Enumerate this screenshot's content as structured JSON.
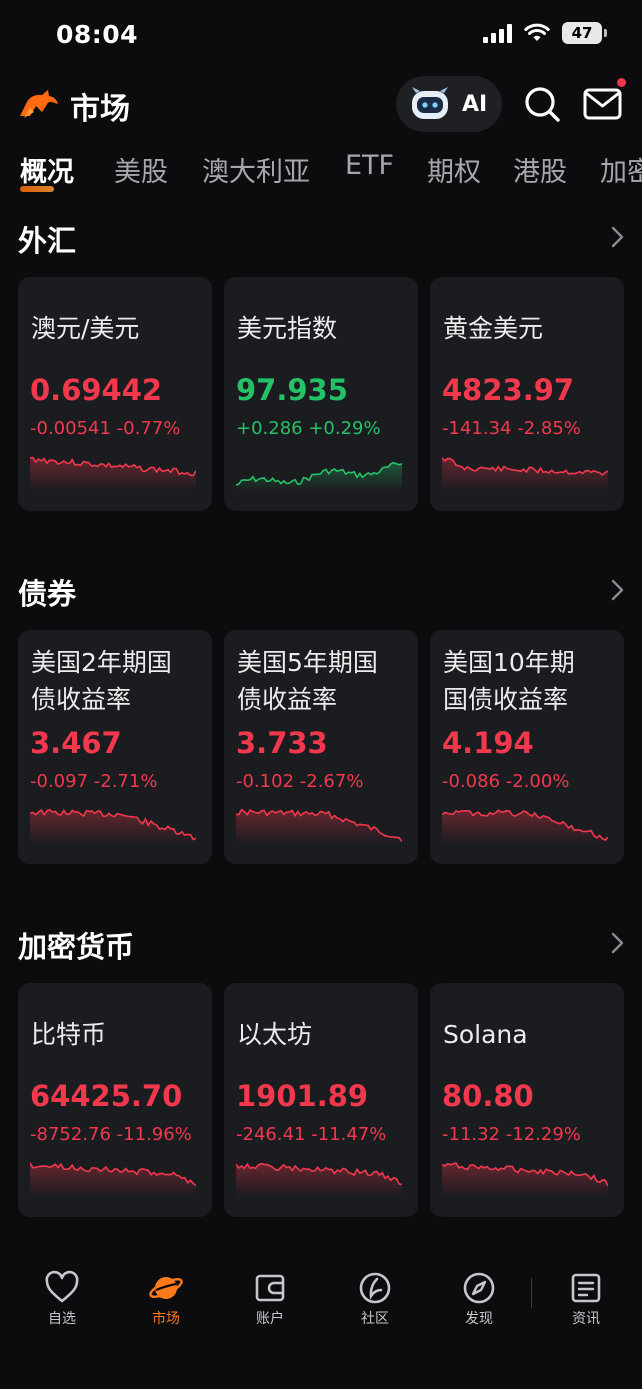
{
  "status_bar": {
    "time": "08:04",
    "battery": "47",
    "icons": [
      "signal-icon",
      "wifi-icon",
      "battery-icon"
    ]
  },
  "header": {
    "title": "市场",
    "ai_label": "AI",
    "icons": [
      "bull-logo-icon",
      "robot-icon",
      "search-icon",
      "mail-icon"
    ],
    "has_notification_dot": true
  },
  "tabs": [
    {
      "label": "概况",
      "active": true
    },
    {
      "label": "美股"
    },
    {
      "label": "澳大利亚"
    },
    {
      "label": "ETF"
    },
    {
      "label": "期权"
    },
    {
      "label": "港股"
    },
    {
      "label": "加密"
    }
  ],
  "sections": [
    {
      "title": "外汇",
      "cards": [
        {
          "name": "澳元/美元",
          "price": "0.69442",
          "change": "-0.00541 -0.77%",
          "trend": "down"
        },
        {
          "name": "美元指数",
          "price": "97.935",
          "change": "+0.286 +0.29%",
          "trend": "up"
        },
        {
          "name": "黄金美元",
          "price": "4823.97",
          "change": "-141.34 -2.85%",
          "trend": "down"
        }
      ]
    },
    {
      "title": "债券",
      "cards": [
        {
          "name": "美国2年期国",
          "name2": "债收益率",
          "price": "3.467",
          "change": "-0.097 -2.71%",
          "trend": "down"
        },
        {
          "name": "美国5年期国",
          "name2": "债收益率",
          "price": "3.733",
          "change": "-0.102 -2.67%",
          "trend": "down"
        },
        {
          "name": "美国10年期",
          "name2": "国债收益率",
          "price": "4.194",
          "change": "-0.086 -2.00%",
          "trend": "down"
        }
      ]
    },
    {
      "title": "加密货币",
      "cards": [
        {
          "name": "比特币",
          "price": "64425.70",
          "change": "-8752.76 -11.96%",
          "trend": "down"
        },
        {
          "name": "以太坊",
          "price": "1901.89",
          "change": "-246.41 -11.47%",
          "trend": "down"
        },
        {
          "name": "Solana",
          "price": "80.80",
          "change": "-11.32 -12.29%",
          "trend": "down"
        }
      ]
    }
  ],
  "bottom_nav": [
    {
      "label": "自选",
      "icon": "heart-icon"
    },
    {
      "label": "市场",
      "icon": "planet-icon",
      "active": true
    },
    {
      "label": "账户",
      "icon": "wallet-icon"
    },
    {
      "label": "社区",
      "icon": "community-icon"
    },
    {
      "label": "发现",
      "icon": "compass-icon"
    },
    {
      "label": "资讯",
      "icon": "news-icon"
    }
  ],
  "colors": {
    "background": "#0c0c0e",
    "card": "#1b1c20",
    "down": "#f2384d",
    "up": "#24c267",
    "accent": "#ff7a1a"
  }
}
